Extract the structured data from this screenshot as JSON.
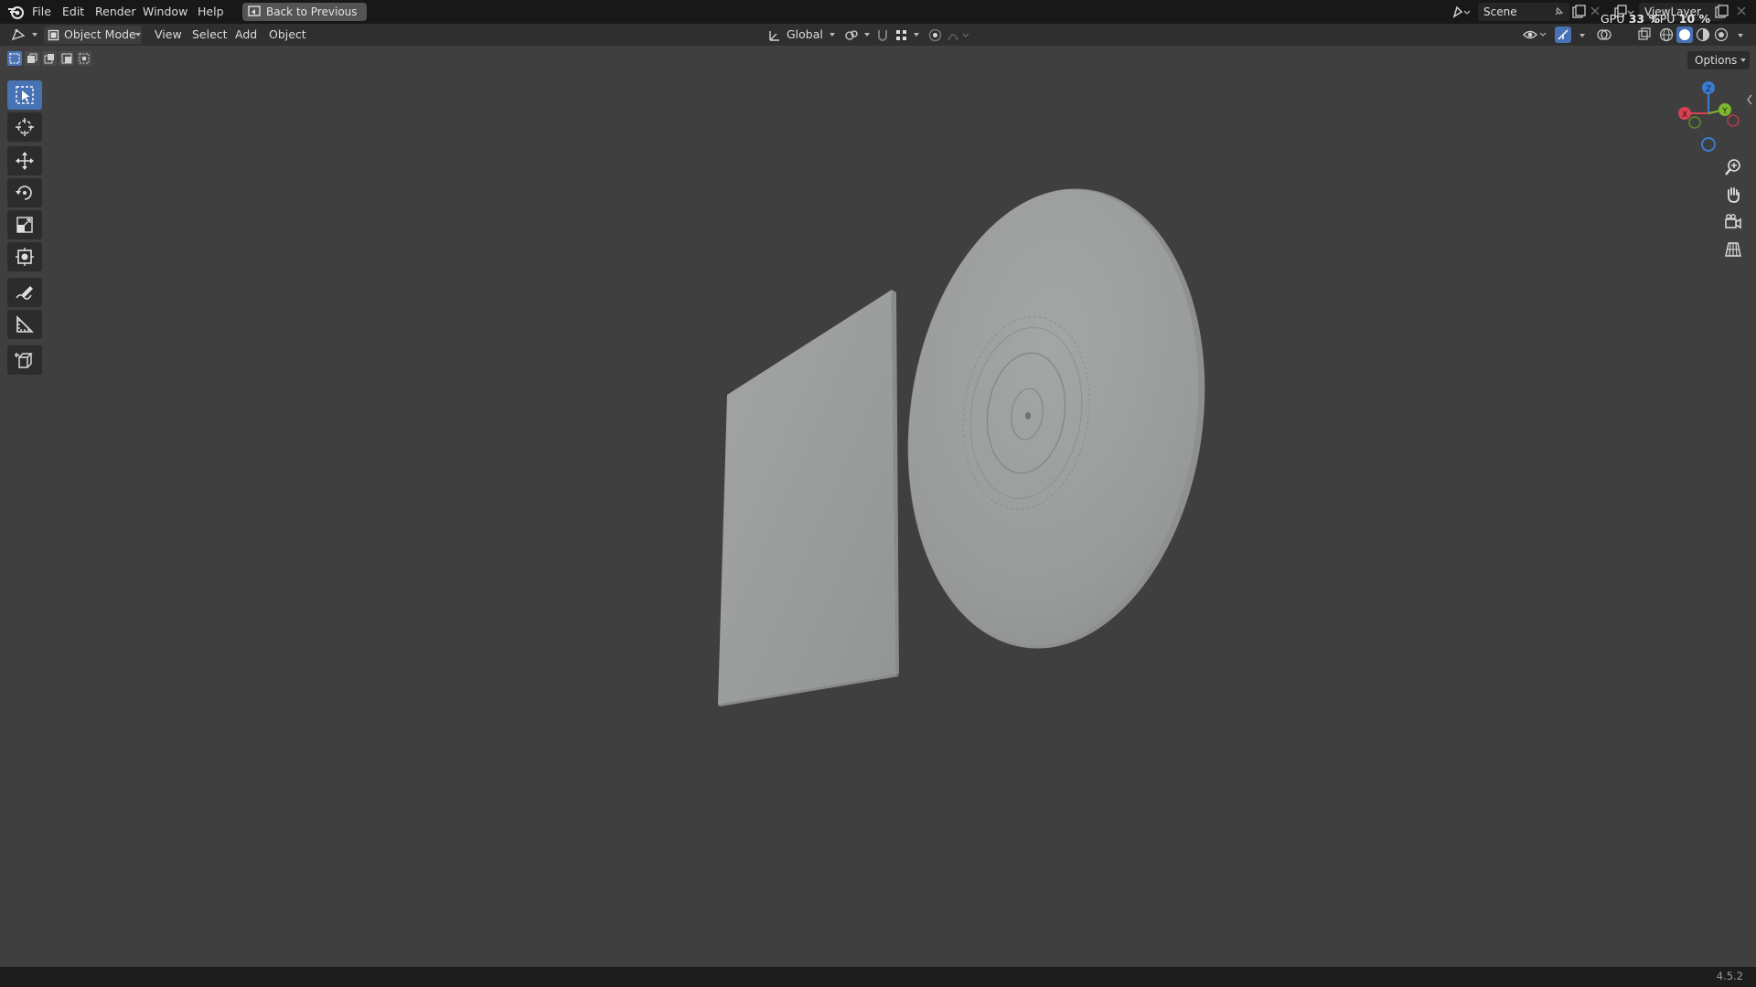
{
  "menubar": {
    "items": [
      "File",
      "Edit",
      "Render",
      "Window",
      "Help"
    ],
    "back_button": "Back to Previous"
  },
  "scene": {
    "name": "Scene"
  },
  "view_layer": {
    "name": "ViewLayer"
  },
  "hud": {
    "gpu_label": "GPU",
    "gpu_value": "33 %",
    "cpu_label": "CPU",
    "cpu_value": "10 %"
  },
  "header": {
    "mode": "Object Mode",
    "menus": [
      "View",
      "Select",
      "Add",
      "Object"
    ],
    "orientation": "Global"
  },
  "toolbar": {
    "tools": [
      "select-box",
      "cursor",
      "move",
      "rotate",
      "scale",
      "transform",
      "annotate",
      "measure",
      "add-cube"
    ],
    "active": "select-box"
  },
  "viewport": {
    "options_label": "Options",
    "gizmo": {
      "x": "X",
      "y": "Y",
      "z": "Z"
    },
    "objects": [
      "album-sleeve",
      "vinyl-record"
    ]
  },
  "colors": {
    "accent": "#4772b3",
    "viewport_bg": "#3f3f3f",
    "object": "#9a9c9c"
  },
  "status": {
    "version": "4.5.2"
  }
}
